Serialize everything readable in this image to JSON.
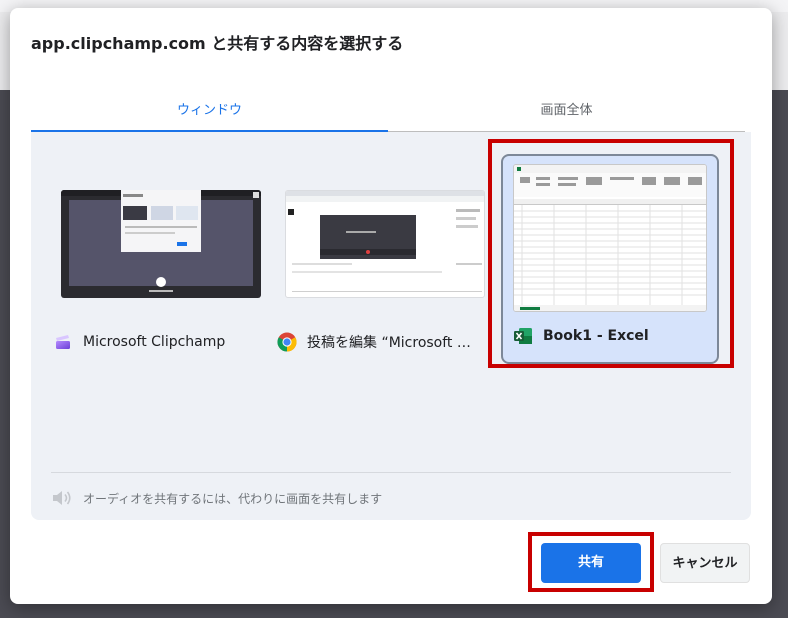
{
  "dialog": {
    "title": "app.clipchamp.com と共有する内容を選択する"
  },
  "tabs": [
    {
      "label": "ウィンドウ",
      "active": true
    },
    {
      "label": "画面全体",
      "active": false
    }
  ],
  "windows": [
    {
      "label": "Microsoft Clipchamp",
      "icon": "clipchamp-icon",
      "selected": false
    },
    {
      "label": "投稿を編集 “Microsoft Clipchamp”",
      "icon": "chrome-icon",
      "selected": false
    },
    {
      "label": "Book1 - Excel",
      "icon": "excel-icon",
      "selected": true
    }
  ],
  "audio_note": "オーディオを共有するには、代わりに画面を共有します",
  "buttons": {
    "share": "共有",
    "cancel": "キャンセル"
  },
  "colors": {
    "accent": "#1a73e8",
    "highlight": "#c80000",
    "selected_card": "#d6e3fb"
  }
}
